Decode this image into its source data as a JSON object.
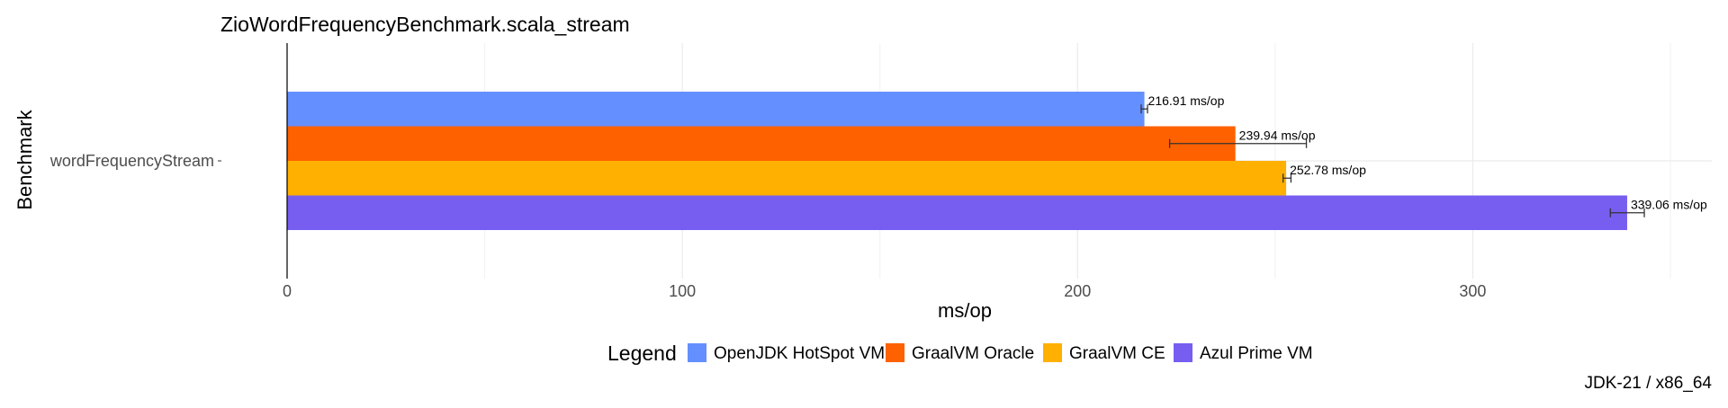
{
  "chart_data": {
    "type": "bar",
    "orientation": "horizontal",
    "title": "ZioWordFrequencyBenchmark.scala_stream",
    "xlabel": "ms/op",
    "ylabel": "Benchmark",
    "caption": "JDK-21 / x86_64",
    "categories": [
      "wordFrequencyStream"
    ],
    "xlim": [
      0,
      360
    ],
    "xticks": [
      0,
      100,
      200,
      300
    ],
    "grid": true,
    "legend_title": "Legend",
    "legend_position": "bottom",
    "series": [
      {
        "name": "OpenJDK HotSpot VM",
        "color": "#648FFF",
        "values": [
          216.91
        ],
        "error": [
          [
            216.1,
            217.7
          ]
        ],
        "label": "216.91 ms/op"
      },
      {
        "name": "GraalVM Oracle",
        "color": "#FE6100",
        "values": [
          239.94
        ],
        "error": [
          [
            223.3,
            257.9
          ]
        ],
        "label": "239.94 ms/op"
      },
      {
        "name": "GraalVM CE",
        "color": "#FFB000",
        "values": [
          252.78
        ],
        "error": [
          [
            252.0,
            254.0
          ]
        ],
        "label": "252.78 ms/op"
      },
      {
        "name": "Azul Prime VM",
        "color": "#785EF0",
        "values": [
          339.06
        ],
        "error": [
          [
            334.8,
            343.4
          ]
        ],
        "label": "339.06 ms/op"
      }
    ]
  }
}
